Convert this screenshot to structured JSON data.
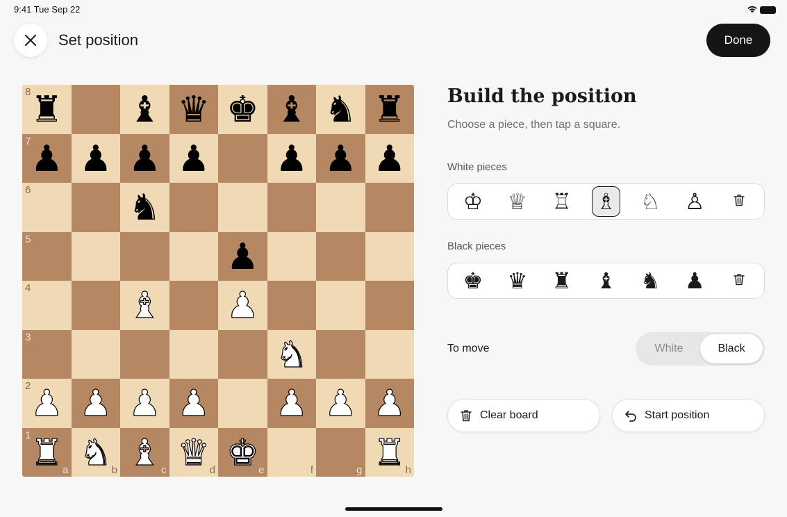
{
  "status": {
    "time": "9:41 Tue Sep 22"
  },
  "header": {
    "title": "Set position",
    "done_label": "Done"
  },
  "board": {
    "files": [
      "a",
      "b",
      "c",
      "d",
      "e",
      "f",
      "g",
      "h"
    ],
    "ranks": [
      "8",
      "7",
      "6",
      "5",
      "4",
      "3",
      "2",
      "1"
    ],
    "rows": [
      [
        "bR",
        "",
        "bB",
        "bQ",
        "bK",
        "bB",
        "bN",
        "bR"
      ],
      [
        "bP",
        "bP",
        "bP",
        "bP",
        "",
        "bP",
        "bP",
        "bP"
      ],
      [
        "",
        "",
        "bN",
        "",
        "",
        "",
        "",
        ""
      ],
      [
        "",
        "",
        "",
        "",
        "bP",
        "",
        "",
        ""
      ],
      [
        "",
        "",
        "wB",
        "",
        "wP",
        "",
        "",
        ""
      ],
      [
        "",
        "",
        "",
        "",
        "",
        "wN",
        "",
        ""
      ],
      [
        "wP",
        "wP",
        "wP",
        "wP",
        "",
        "wP",
        "wP",
        "wP"
      ],
      [
        "wR",
        "wN",
        "wB",
        "wQ",
        "wK",
        "",
        "",
        "wR"
      ]
    ],
    "glyphs": {
      "K": "♚",
      "Q": "♛",
      "R": "♜",
      "B": "♝",
      "N": "♞",
      "P": "♟"
    },
    "colors": {
      "light": "#f0d9b5",
      "dark": "#b58863"
    }
  },
  "panel": {
    "heading": "Build the position",
    "subtitle": "Choose a piece, then tap a square.",
    "white_label": "White pieces",
    "black_label": "Black pieces",
    "white_palette": [
      {
        "glyph": "♔",
        "icon": "white-king-icon"
      },
      {
        "glyph": "♕",
        "icon": "white-queen-icon"
      },
      {
        "glyph": "♖",
        "icon": "white-rook-icon"
      },
      {
        "glyph": "♗",
        "icon": "white-bishop-icon",
        "selected": true
      },
      {
        "glyph": "♘",
        "icon": "white-knight-icon"
      },
      {
        "glyph": "♙",
        "icon": "white-pawn-icon"
      },
      {
        "glyph": "",
        "icon": "trash-icon"
      }
    ],
    "black_palette": [
      {
        "glyph": "♚",
        "icon": "black-king-icon"
      },
      {
        "glyph": "♛",
        "icon": "black-queen-icon"
      },
      {
        "glyph": "♜",
        "icon": "black-rook-icon"
      },
      {
        "glyph": "♝",
        "icon": "black-bishop-icon"
      },
      {
        "glyph": "♞",
        "icon": "black-knight-icon"
      },
      {
        "glyph": "♟",
        "icon": "black-pawn-icon"
      },
      {
        "glyph": "",
        "icon": "trash-icon"
      }
    ],
    "to_move_label": "To move",
    "to_move_options": [
      "White",
      "Black"
    ],
    "to_move_selected": "Black",
    "clear_label": "Clear board",
    "start_label": "Start position"
  }
}
